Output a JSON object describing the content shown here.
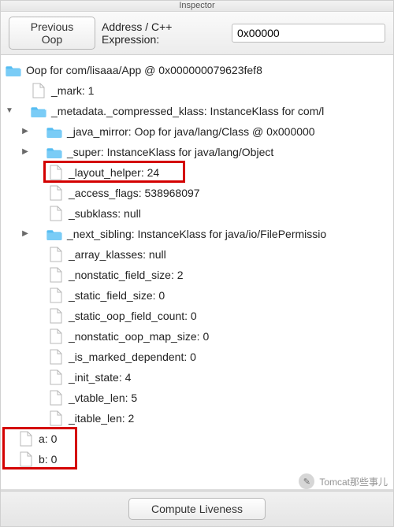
{
  "window": {
    "title": "Inspector"
  },
  "toolbar": {
    "prev_label": "Previous Oop",
    "addr_label": "Address / C++ Expression:",
    "addr_value": "0x00000"
  },
  "tree": {
    "root": {
      "label": "Oop for com/lisaaa/App @ 0x000000079623fef8"
    },
    "mark": {
      "label": "_mark: 1"
    },
    "metadata": {
      "label": "_metadata._compressed_klass: InstanceKlass for com/l"
    },
    "java_mirror": {
      "label": "_java_mirror: Oop for java/lang/Class @ 0x000000"
    },
    "super": {
      "label": "_super: InstanceKlass for java/lang/Object"
    },
    "layout_helper": {
      "label": "_layout_helper: 24"
    },
    "access_flags": {
      "label": "_access_flags: 538968097"
    },
    "subklass": {
      "label": "_subklass: null"
    },
    "next_sibling": {
      "label": "_next_sibling: InstanceKlass for java/io/FilePermissio"
    },
    "array_klasses": {
      "label": "_array_klasses: null"
    },
    "nonstatic_field_size": {
      "label": "_nonstatic_field_size: 2"
    },
    "static_field_size": {
      "label": "_static_field_size: 0"
    },
    "static_oop_field_count": {
      "label": "_static_oop_field_count: 0"
    },
    "nonstatic_oop_map_size": {
      "label": "_nonstatic_oop_map_size: 0"
    },
    "is_marked_dependent": {
      "label": "_is_marked_dependent: 0"
    },
    "init_state": {
      "label": "_init_state: 4"
    },
    "vtable_len": {
      "label": "_vtable_len: 5"
    },
    "itable_len": {
      "label": "_itable_len: 2"
    },
    "a": {
      "label": "a: 0"
    },
    "b": {
      "label": "b: 0"
    }
  },
  "bottom": {
    "compute_label": "Compute Liveness"
  },
  "watermark": {
    "text": "Tomcat那些事儿"
  }
}
